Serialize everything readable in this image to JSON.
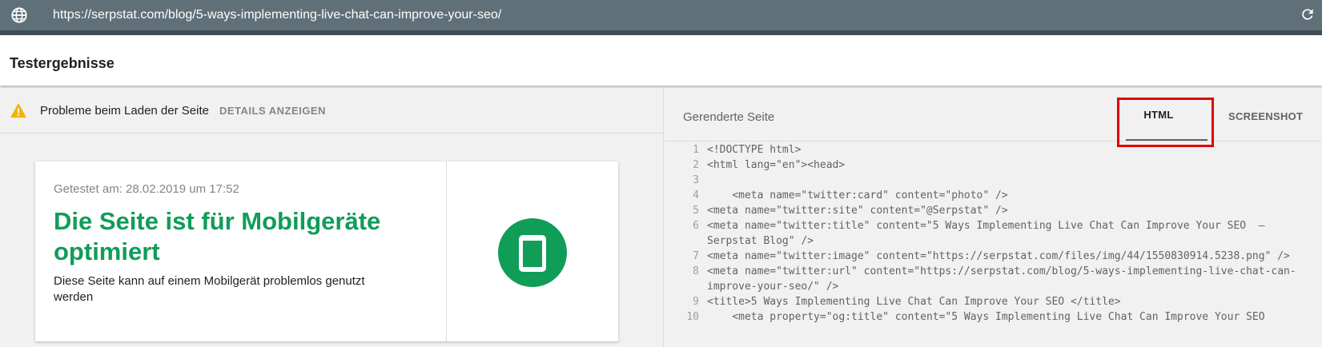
{
  "browser": {
    "url": "https://serpstat.com/blog/5-ways-implementing-live-chat-can-improve-your-seo/"
  },
  "header": {
    "title": "Testergebnisse"
  },
  "issues": {
    "message": "Probleme beim Laden der Seite",
    "details_link": "DETAILS ANZEIGEN"
  },
  "result_card": {
    "tested_at": "Getestet am: 28.02.2019 um 17:52",
    "headline": "Die Seite ist für Mobilgeräte optimiert",
    "description": "Diese Seite kann auf einem Mobilgerät problemlos genutzt werden"
  },
  "rendered_panel": {
    "title": "Gerenderte Seite",
    "tabs": [
      {
        "label": "HTML",
        "active": true
      },
      {
        "label": "SCREENSHOT",
        "active": false
      }
    ]
  },
  "code_lines": [
    {
      "n": "1",
      "text": "<!DOCTYPE html>"
    },
    {
      "n": "2",
      "text": "<html lang=\"en\"><head>"
    },
    {
      "n": "3",
      "text": ""
    },
    {
      "n": "4",
      "text": "    <meta name=\"twitter:card\" content=\"photo\" />"
    },
    {
      "n": "5",
      "text": "<meta name=\"twitter:site\" content=\"@Serpstat\" />"
    },
    {
      "n": "6",
      "text": "<meta name=\"twitter:title\" content=\"5 Ways Implementing Live Chat Can Improve Your SEO  – Serpstat Blog\" />"
    },
    {
      "n": "7",
      "text": "<meta name=\"twitter:image\" content=\"https://serpstat.com/files/img/44/1550830914.5238.png\" />"
    },
    {
      "n": "8",
      "text": "<meta name=\"twitter:url\" content=\"https://serpstat.com/blog/5-ways-implementing-live-chat-can-improve-your-seo/\" />"
    },
    {
      "n": "9",
      "text": "<title>5 Ways Implementing Live Chat Can Improve Your SEO </title>"
    },
    {
      "n": "10",
      "text": "    <meta property=\"og:title\" content=\"5 Ways Implementing Live Chat Can Improve Your SEO"
    }
  ],
  "colors": {
    "urlbar": "#5f7078",
    "success_green": "#0f9d58",
    "warning_yellow": "#f4b400",
    "highlight_red": "#e00000"
  }
}
